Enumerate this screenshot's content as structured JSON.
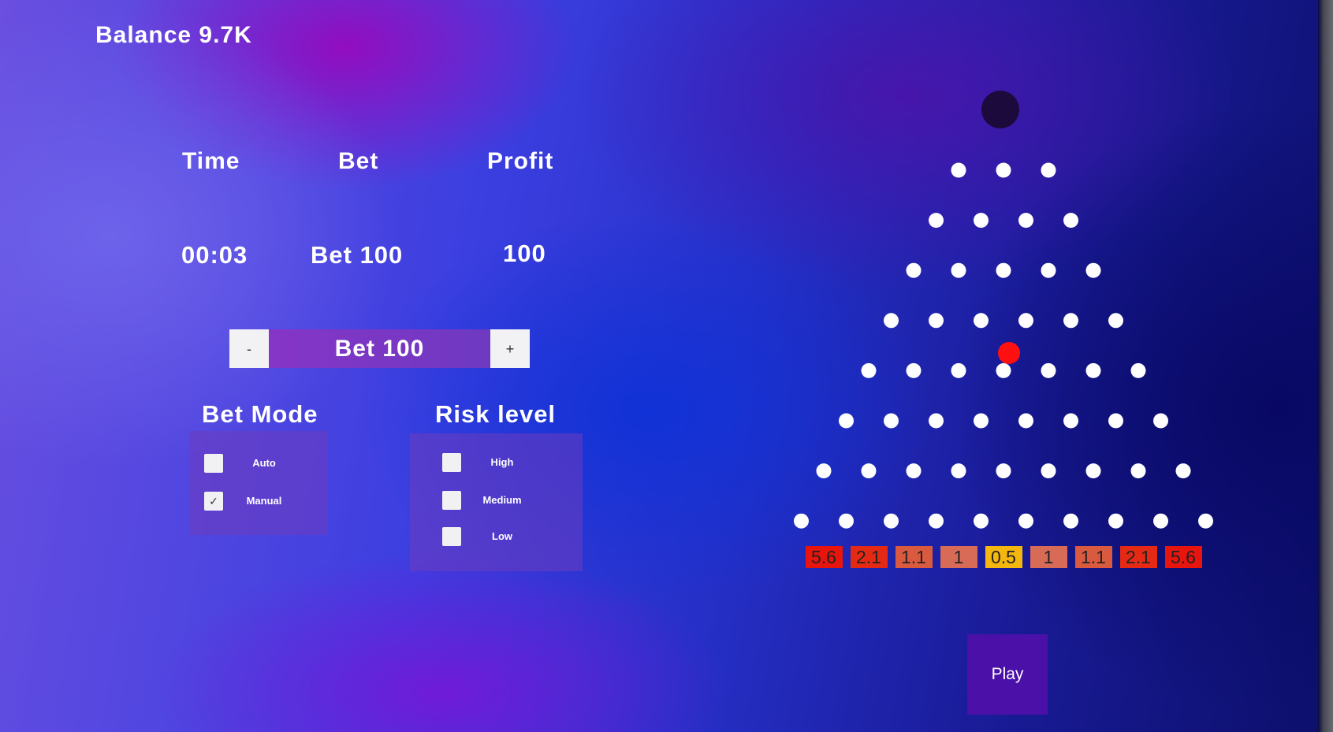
{
  "balance": {
    "label": "Balance 9.7K"
  },
  "history": {
    "headers": {
      "time": "Time",
      "bet": "Bet",
      "profit": "Profit"
    },
    "row": {
      "time": "00:03",
      "bet": "Bet 100",
      "profit": "100"
    }
  },
  "bet_control": {
    "minus_label": "-",
    "value": "Bet 100",
    "plus_label": "+"
  },
  "bet_mode": {
    "title": "Bet Mode",
    "options": [
      {
        "label": "Auto",
        "checked": false
      },
      {
        "label": "Manual",
        "checked": true
      }
    ]
  },
  "risk_level": {
    "title": "Risk level",
    "options": [
      {
        "label": "High",
        "checked": false
      },
      {
        "label": "Medium",
        "checked": false
      },
      {
        "label": "Low",
        "checked": false
      }
    ]
  },
  "board": {
    "peg_rows": 8,
    "first_row_pegs": 3,
    "dropper_color": "#1c0a3c",
    "peg_color": "#ffffff",
    "ball_color": "#ff1010"
  },
  "multipliers": [
    {
      "label": "5.6",
      "color": "#e8150e"
    },
    {
      "label": "2.1",
      "color": "#e42a14"
    },
    {
      "label": "1.1",
      "color": "#da5a40"
    },
    {
      "label": "1",
      "color": "#d86b57"
    },
    {
      "label": "0.5",
      "color": "#f5b70e"
    },
    {
      "label": "1",
      "color": "#d86b57"
    },
    {
      "label": "1.1",
      "color": "#da5a40"
    },
    {
      "label": "2.1",
      "color": "#e42a14"
    },
    {
      "label": "5.6",
      "color": "#e8150e"
    }
  ],
  "play_button": {
    "label": "Play"
  }
}
